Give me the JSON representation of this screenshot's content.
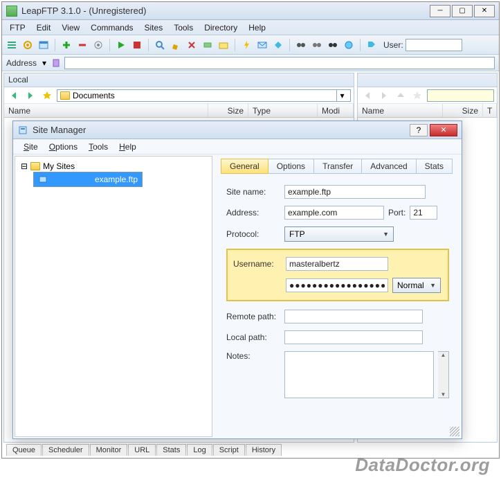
{
  "window": {
    "title": "LeapFTP 3.1.0 - (Unregistered)"
  },
  "menubar": [
    "FTP",
    "Edit",
    "View",
    "Commands",
    "Sites",
    "Tools",
    "Directory",
    "Help"
  ],
  "toolbar": {
    "user_label": "User:",
    "user_value": ""
  },
  "addressbar": {
    "label": "Address",
    "value": ""
  },
  "panes": {
    "left": {
      "title": "Local",
      "path": "Documents",
      "cols": {
        "name": "Name",
        "size": "Size",
        "type": "Type",
        "mod": "Modi"
      }
    },
    "right": {
      "path": "",
      "cols": {
        "name": "Name",
        "size": "Size",
        "type": "T"
      }
    }
  },
  "bottom_tabs": [
    "Queue",
    "Scheduler",
    "Monitor",
    "URL",
    "Stats",
    "Log",
    "Script",
    "History"
  ],
  "dialog": {
    "title": "Site Manager",
    "menu": [
      {
        "label": "Site",
        "u": 0
      },
      {
        "label": "Options",
        "u": 0
      },
      {
        "label": "Tools",
        "u": 0
      },
      {
        "label": "Help",
        "u": 0
      }
    ],
    "tree": {
      "root": "My Sites",
      "items": [
        "example.ftp"
      ]
    },
    "tabs": [
      "General",
      "Options",
      "Transfer",
      "Advanced",
      "Stats"
    ],
    "active_tab": 0,
    "form": {
      "site_name_label": "Site name:",
      "site_name": "example.ftp",
      "address_label": "Address:",
      "address": "example.com",
      "port_label": "Port:",
      "port": "21",
      "protocol_label": "Protocol:",
      "protocol": "FTP",
      "username_label": "Username:",
      "username": "masteralbertz",
      "password": "●●●●●●●●●●●●●●●●●●●",
      "login_mode": "Normal",
      "remote_path_label": "Remote path:",
      "remote_path": "",
      "local_path_label": "Local path:",
      "local_path": "",
      "notes_label": "Notes:",
      "notes": ""
    }
  },
  "watermark": "DataDoctor.org"
}
